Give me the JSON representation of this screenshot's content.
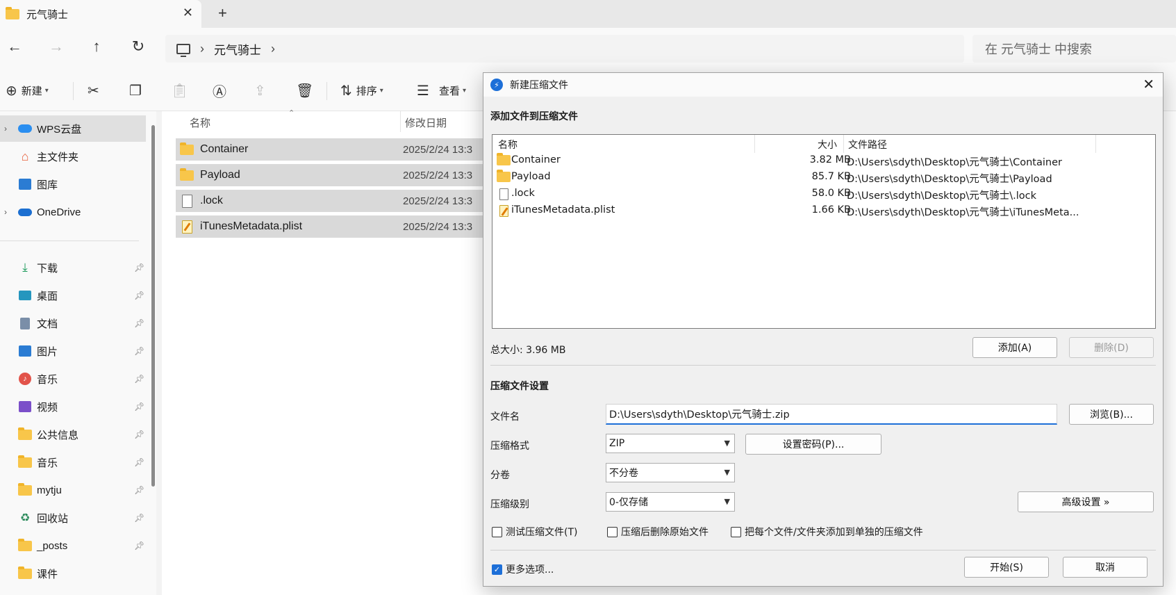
{
  "tab": {
    "title": "元气骑士",
    "close": "✕",
    "new": "+"
  },
  "nav": {
    "back": "←",
    "forward": "→",
    "up": "↑",
    "refresh": "↻"
  },
  "breadcrumb": {
    "items": [
      "元气骑士"
    ]
  },
  "search": {
    "placeholder": "在 元气骑士 中搜索"
  },
  "commands": {
    "new_label": "新建",
    "sort_label": "排序",
    "view_label": "查看"
  },
  "sidebar": {
    "items": [
      {
        "label": "WPS云盘",
        "icon": "cloud-icon"
      },
      {
        "label": "主文件夹",
        "icon": "home-icon"
      },
      {
        "label": "图库",
        "icon": "gallery-icon"
      },
      {
        "label": "OneDrive",
        "icon": "onedrive-icon"
      },
      {
        "label": "下载",
        "icon": "download-icon"
      },
      {
        "label": "桌面",
        "icon": "desktop-icon"
      },
      {
        "label": "文档",
        "icon": "document-icon"
      },
      {
        "label": "图片",
        "icon": "pictures-icon"
      },
      {
        "label": "音乐",
        "icon": "music-icon"
      },
      {
        "label": "视频",
        "icon": "video-icon"
      },
      {
        "label": "公共信息",
        "icon": "folder-icon"
      },
      {
        "label": "音乐",
        "icon": "folder-icon"
      },
      {
        "label": "mytju",
        "icon": "folder-icon"
      },
      {
        "label": "回收站",
        "icon": "recycle-bin-icon"
      },
      {
        "label": "_posts",
        "icon": "folder-icon"
      },
      {
        "label": "课件",
        "icon": "folder-icon"
      }
    ]
  },
  "filelist": {
    "columns": {
      "name": "名称",
      "modified": "修改日期"
    },
    "rows": [
      {
        "name": "Container",
        "date": "2025/2/24 13:3",
        "type": "folder"
      },
      {
        "name": "Payload",
        "date": "2025/2/24 13:3",
        "type": "folder"
      },
      {
        "name": ".lock",
        "date": "2025/2/24 13:3",
        "type": "file"
      },
      {
        "name": "iTunesMetadata.plist",
        "date": "2025/2/24 13:3",
        "type": "plist"
      }
    ]
  },
  "dialog": {
    "title": "新建压缩文件",
    "section_add": "添加文件到压缩文件",
    "columns": {
      "name": "名称",
      "size": "大小",
      "path": "文件路径"
    },
    "files": [
      {
        "name": "Container",
        "size": "3.82 MB",
        "path": "D:\\Users\\sdyth\\Desktop\\元气骑士\\Container",
        "type": "folder"
      },
      {
        "name": "Payload",
        "size": "85.7 KB",
        "path": "D:\\Users\\sdyth\\Desktop\\元气骑士\\Payload",
        "type": "folder"
      },
      {
        "name": ".lock",
        "size": "58.0 KB",
        "path": "D:\\Users\\sdyth\\Desktop\\元气骑士\\.lock",
        "type": "file"
      },
      {
        "name": "iTunesMetadata.plist",
        "size": "1.66 KB",
        "path": "D:\\Users\\sdyth\\Desktop\\元气骑士\\iTunesMeta...",
        "type": "plist"
      }
    ],
    "total": "总大小: 3.96 MB",
    "add_button": "添加(A)",
    "delete_button": "删除(D)",
    "section_settings": "压缩文件设置",
    "filename_label": "文件名",
    "filename_value": "D:\\Users\\sdyth\\Desktop\\元气骑士.zip",
    "browse_button": "浏览(B)...",
    "format_label": "压缩格式",
    "format_value": "ZIP",
    "password_button": "设置密码(P)...",
    "volume_label": "分卷",
    "volume_value": "不分卷",
    "level_label": "压缩级别",
    "level_value": "0-仅存储",
    "advanced_button": "高级设置 »",
    "check_test": "测试压缩文件(T)",
    "check_delete": "压缩后删除原始文件",
    "check_separate": "把每个文件/文件夹添加到单独的压缩文件",
    "check_more": "更多选项...",
    "start_button": "开始(S)",
    "cancel_button": "取消"
  }
}
